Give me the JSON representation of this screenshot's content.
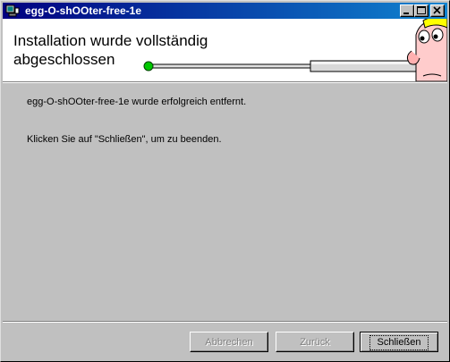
{
  "window": {
    "title": "egg-O-shOOter-free-1e",
    "icon": "installer-computer-icon"
  },
  "titlebar_buttons": {
    "minimize": "minimize-icon",
    "maximize": "maximize-icon",
    "close": "close-icon"
  },
  "banner": {
    "title_line1": "Installation wurde vollständig",
    "title_line2": "abgeschlossen",
    "progress": 1.0,
    "dot_color": "#00c800"
  },
  "content": {
    "message1": "egg-O-shOOter-free-1e wurde erfolgreich entfernt.",
    "message2": "Klicken Sie auf \"Schließen\", um zu beenden."
  },
  "buttons": {
    "cancel": "Abbrechen",
    "back": "Zurück",
    "close": "Schließen"
  },
  "colors": {
    "titlebar_start": "#000080",
    "titlebar_end": "#1084d0",
    "face_background": "#c0c0c0"
  }
}
